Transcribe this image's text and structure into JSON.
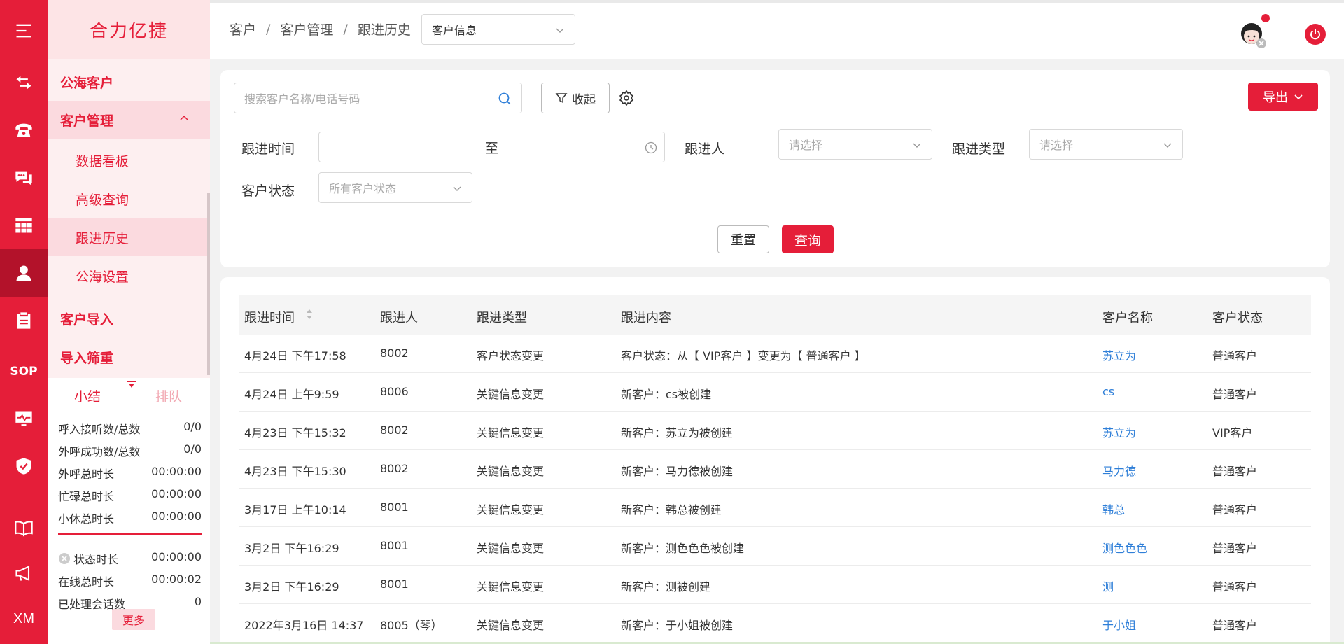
{
  "colors": {
    "primary": "#e51e39",
    "link": "#2f7fd8"
  },
  "rail": {
    "items": [
      {
        "icon": "menu-icon"
      },
      {
        "icon": "transfer-icon"
      },
      {
        "icon": "telephone-icon"
      },
      {
        "icon": "chat-icon"
      },
      {
        "icon": "grid-icon"
      },
      {
        "icon": "user-icon"
      },
      {
        "icon": "clipboard-icon"
      },
      {
        "label": "SOP"
      },
      {
        "icon": "monitor-icon"
      },
      {
        "icon": "shield-icon"
      },
      {
        "icon": "book-icon"
      },
      {
        "icon": "megaphone-icon"
      },
      {
        "label": "XM"
      }
    ]
  },
  "sidebar": {
    "brand": "合力亿捷",
    "groups": {
      "public_sea": "公海客户",
      "customer_mgmt": "客户管理",
      "import": "客户导入",
      "import_filter": "导入筛重"
    },
    "subs": {
      "dashboard": "数据看板",
      "advanced": "高级查询",
      "history": "跟进历史",
      "sea_settings": "公海设置"
    }
  },
  "stats": {
    "tab_summary": "小结",
    "tab_queue": "排队",
    "rows": [
      {
        "label": "呼入接听数/总数",
        "value": "0/0"
      },
      {
        "label": "外呼成功数/总数",
        "value": "0/0"
      },
      {
        "label": "外呼总时长",
        "value": "00:00:00"
      },
      {
        "label": "忙碌总时长",
        "value": "00:00:00"
      },
      {
        "label": "小休总时长",
        "value": "00:00:00"
      }
    ],
    "rows2": [
      {
        "label": "状态时长",
        "value": "00:00:00"
      },
      {
        "label": "在线总时长",
        "value": "00:00:02"
      },
      {
        "label": "已处理会话数",
        "value": "0"
      }
    ],
    "more": "更多"
  },
  "header": {
    "crumbs": [
      "客户",
      "客户管理",
      "跟进历史"
    ],
    "sep": "/",
    "info_select": "客户信息"
  },
  "filter": {
    "search_placeholder": "搜索客户名称/电话号码",
    "collapse": "收起",
    "export": "导出",
    "time_label": "跟进时间",
    "date_to": "至",
    "person_label": "跟进人",
    "person_placeholder": "请选择",
    "type_label": "跟进类型",
    "type_placeholder": "请选择",
    "status_label": "客户状态",
    "status_placeholder": "所有客户状态",
    "reset": "重置",
    "query": "查询"
  },
  "table": {
    "columns": [
      "跟进时间",
      "跟进人",
      "跟进类型",
      "跟进内容",
      "客户名称",
      "客户状态"
    ],
    "rows": [
      {
        "time": "4月24日 下午17:58",
        "person": "8002",
        "type": "客户状态变更",
        "content": "客户状态：从【 VIP客户 】变更为【 普通客户 】",
        "name": "苏立为",
        "status": "普通客户"
      },
      {
        "time": "4月24日 上午9:59",
        "person": "8006",
        "type": "关键信息变更",
        "content": "新客户：cs被创建",
        "name": "cs",
        "status": "普通客户"
      },
      {
        "time": "4月23日 下午15:32",
        "person": "8002",
        "type": "关键信息变更",
        "content": "新客户：苏立为被创建",
        "name": "苏立为",
        "status": "VIP客户"
      },
      {
        "time": "4月23日 下午15:30",
        "person": "8002",
        "type": "关键信息变更",
        "content": "新客户：马力德被创建",
        "name": "马力德",
        "status": "普通客户"
      },
      {
        "time": "3月17日 上午10:14",
        "person": "8001",
        "type": "关键信息变更",
        "content": "新客户：韩总被创建",
        "name": "韩总",
        "status": "普通客户"
      },
      {
        "time": "3月2日 下午16:29",
        "person": "8001",
        "type": "关键信息变更",
        "content": "新客户：测色色色被创建",
        "name": "测色色色",
        "status": "普通客户"
      },
      {
        "time": "3月2日 下午16:29",
        "person": "8001",
        "type": "关键信息变更",
        "content": "新客户：测被创建",
        "name": "测",
        "status": "普通客户"
      },
      {
        "time": "2022年3月16日 14:37",
        "person": "8005（琴）",
        "type": "关键信息变更",
        "content": "新客户：于小姐被创建",
        "name": "于小姐",
        "status": "普通客户"
      }
    ]
  }
}
